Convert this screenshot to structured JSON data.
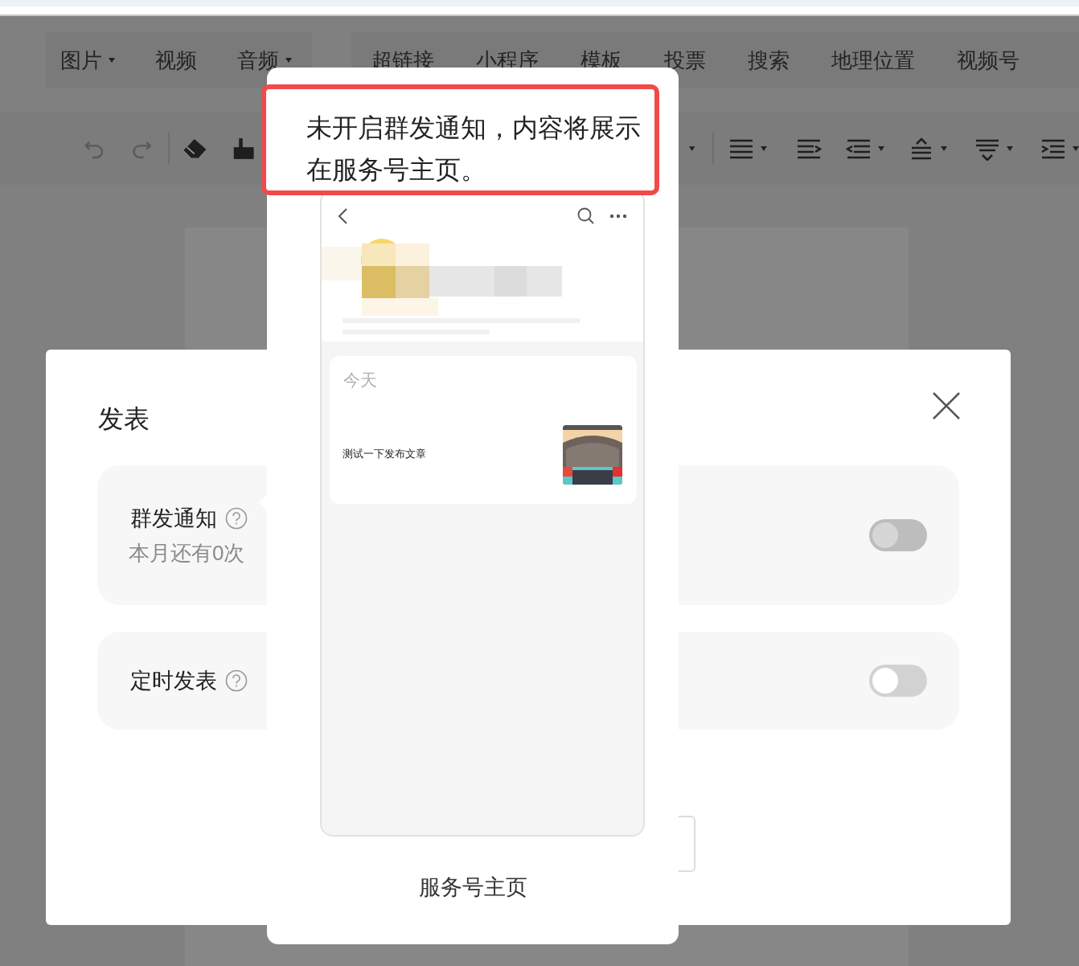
{
  "insert_toolbar": {
    "groups": [
      {
        "items": [
          {
            "label": "图片",
            "dropdown": true
          },
          {
            "label": "视频",
            "dropdown": false
          },
          {
            "label": "音频",
            "dropdown": true
          }
        ]
      },
      {
        "items": [
          {
            "label": "超链接",
            "dropdown": false
          },
          {
            "label": "小程序",
            "dropdown": false
          },
          {
            "label": "模板",
            "dropdown": false
          },
          {
            "label": "投票",
            "dropdown": false
          },
          {
            "label": "搜索",
            "dropdown": false
          },
          {
            "label": "地理位置",
            "dropdown": false
          },
          {
            "label": "视频号",
            "dropdown": false
          }
        ]
      }
    ]
  },
  "dialog": {
    "title": "发表",
    "settings": [
      {
        "label": "群发通知",
        "description": "本月还有0次",
        "on": false,
        "disabled": true
      },
      {
        "label": "定时发表",
        "on": false,
        "disabled": false
      }
    ]
  },
  "popover": {
    "notice": "未开启群发通知，内容将展示在服务号主页。",
    "preview": {
      "section_title": "今天",
      "article_title": "测试一下发布文章"
    },
    "caption": "服务号主页"
  }
}
